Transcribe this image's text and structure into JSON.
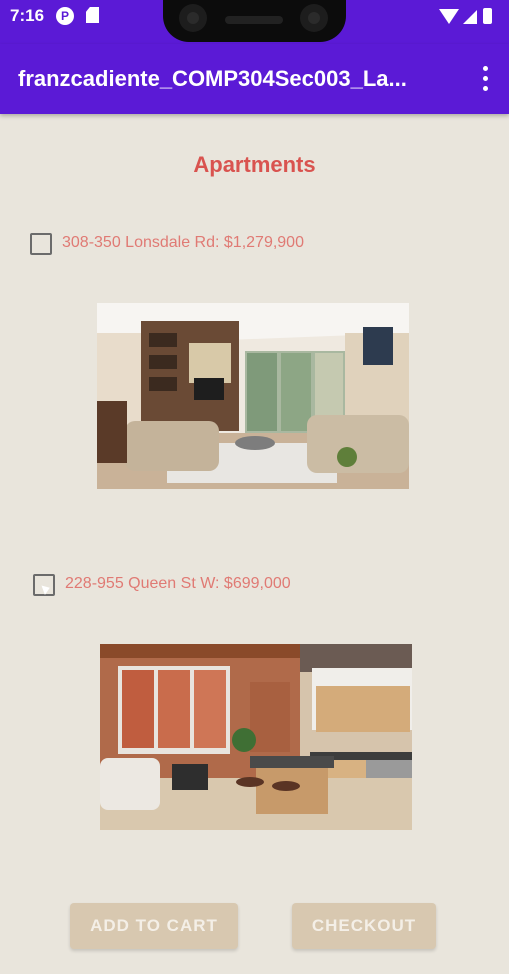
{
  "status_bar": {
    "time": "7:16",
    "icons": [
      "p-notification-icon",
      "sd-card-icon",
      "wifi-icon",
      "signal-icon",
      "battery-icon"
    ]
  },
  "app_bar": {
    "title": "franzcadiente_COMP304Sec003_La...",
    "menu_icon": "more-vert-icon"
  },
  "content": {
    "heading": "Apartments",
    "listings": [
      {
        "label": "308-350 Lonsdale Rd: $1,279,900",
        "checked": false
      },
      {
        "label": "228-955 Queen St W: $699,000",
        "checked": false
      }
    ]
  },
  "buttons": {
    "add_to_cart": "ADD TO CART",
    "checkout": "CHECKOUT"
  },
  "colors": {
    "app_bar": "#5b1ad6",
    "background": "#e9e5dc",
    "heading": "#d9534f",
    "listing_text": "#e07a74",
    "button_bg": "#d8c8b0"
  }
}
